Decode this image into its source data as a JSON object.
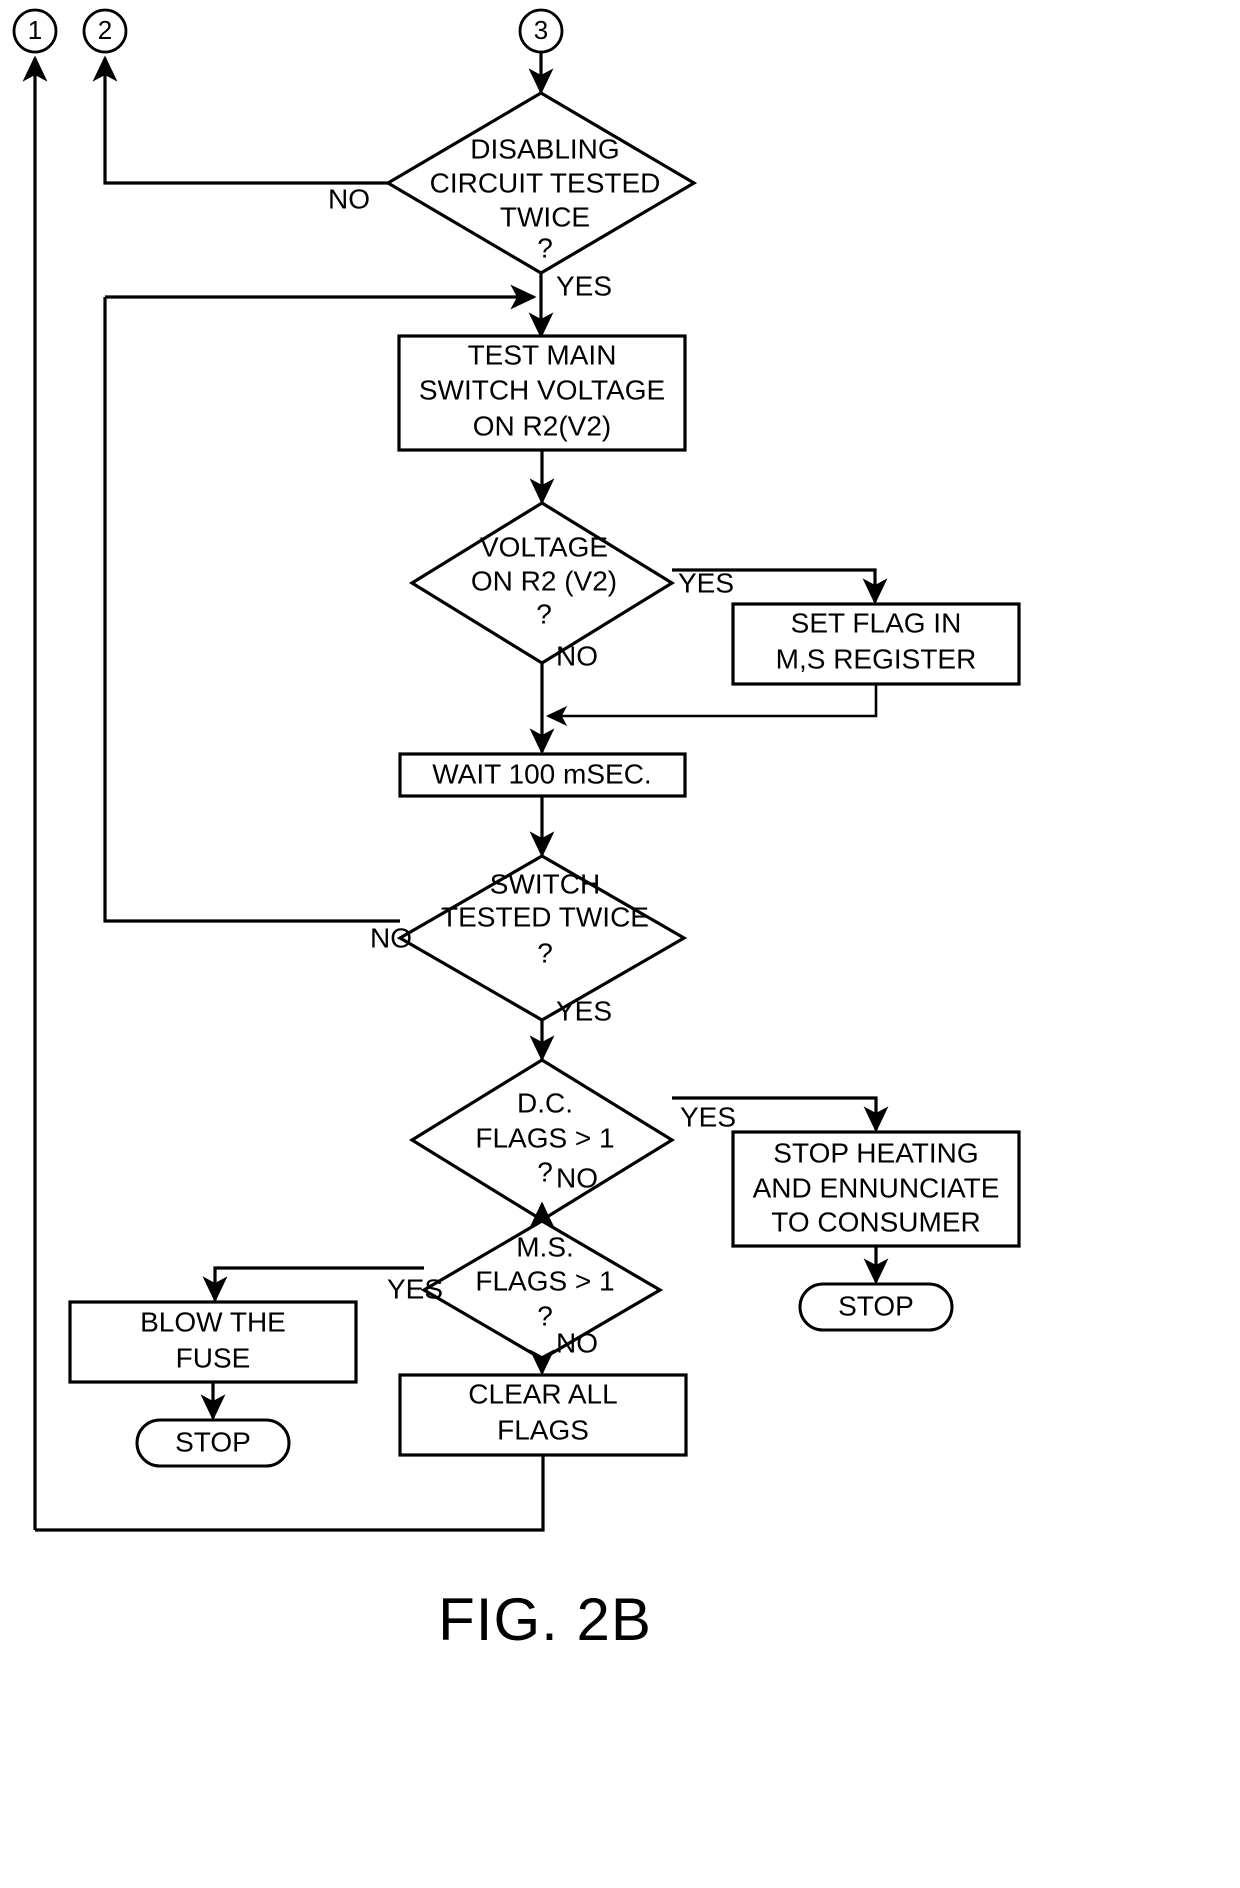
{
  "figure": {
    "caption": "FIG. 2B",
    "type": "flowchart"
  },
  "connectors": [
    {
      "id": "conn-1",
      "label": "1"
    },
    {
      "id": "conn-2",
      "label": "2"
    },
    {
      "id": "conn-3",
      "label": "3"
    }
  ],
  "nodes": {
    "disabling_tested": {
      "shape": "decision",
      "line1": "DISABLING",
      "line2": "CIRCUIT TESTED",
      "line3": "TWICE",
      "line4": "?"
    },
    "test_main_switch": {
      "shape": "process",
      "line1": "TEST MAIN",
      "line2": "SWITCH VOLTAGE",
      "line3": "ON R2(V2)"
    },
    "voltage_on_r2": {
      "shape": "decision",
      "line1": "VOLTAGE",
      "line2": "ON R2 (V2)",
      "line3": "?"
    },
    "set_flag": {
      "shape": "process",
      "line1": "SET FLAG IN",
      "line2": "M,S REGISTER"
    },
    "wait_100": {
      "shape": "process",
      "line1": "WAIT 100 mSEC."
    },
    "switch_tested_twice": {
      "shape": "decision",
      "line1": "SWITCH",
      "line2": "TESTED TWICE",
      "line3": "?"
    },
    "dc_flags": {
      "shape": "decision",
      "line1": "D.C.",
      "line2": "FLAGS > 1",
      "line3": "?"
    },
    "ms_flags": {
      "shape": "decision",
      "line1": "M.S.",
      "line2": "FLAGS > 1",
      "line3": "?"
    },
    "stop_heating": {
      "shape": "process",
      "line1": "STOP HEATING",
      "line2": "AND ENNUNCIATE",
      "line3": "TO CONSUMER"
    },
    "blow_fuse": {
      "shape": "process",
      "line1": "BLOW THE",
      "line2": "FUSE"
    },
    "clear_flags": {
      "shape": "process",
      "line1": "CLEAR ALL",
      "line2": "FLAGS"
    },
    "stop_right": {
      "shape": "terminator",
      "line1": "STOP"
    },
    "stop_left": {
      "shape": "terminator",
      "line1": "STOP"
    }
  },
  "edge_labels": {
    "disabling_no": "NO",
    "disabling_yes": "YES",
    "voltage_yes": "YES",
    "voltage_no": "NO",
    "switch_no": "NO",
    "switch_yes": "YES",
    "dc_yes": "YES",
    "dc_no": "NO",
    "ms_yes": "YES",
    "ms_no": "NO"
  },
  "colors": {
    "ink": "#000000",
    "paper": "#ffffff"
  }
}
